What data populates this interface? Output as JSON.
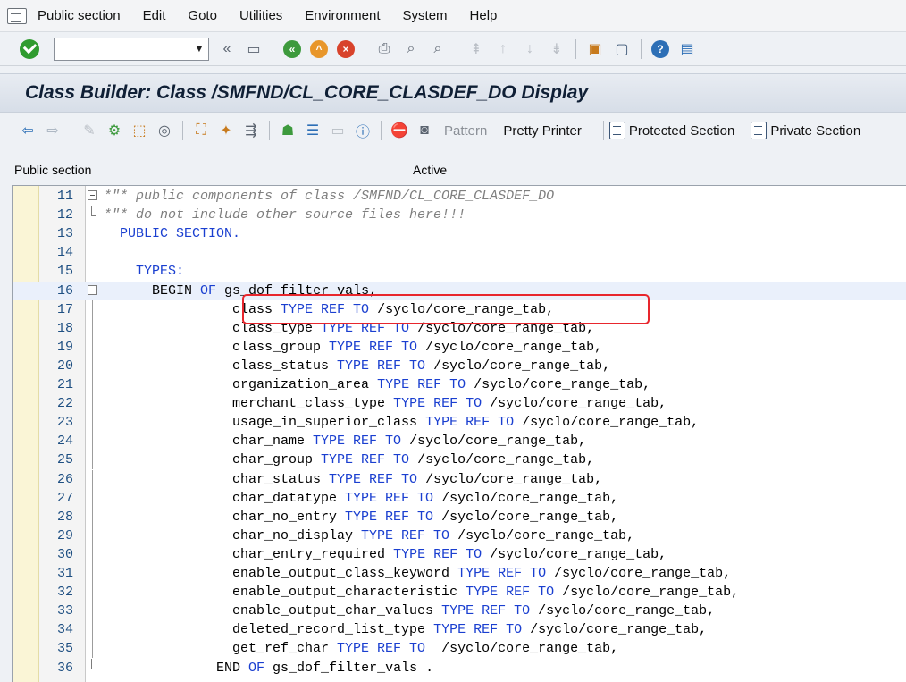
{
  "menu": [
    "Public section",
    "Edit",
    "Goto",
    "Utilities",
    "Environment",
    "System",
    "Help"
  ],
  "title": "Class Builder: Class /SMFND/CL_CORE_CLASDEF_DO Display",
  "app_toolbar": {
    "pattern_label": "Pattern",
    "pretty_printer_label": "Pretty Printer",
    "protected_section_label": "Protected Section",
    "private_section_label": "Private Section"
  },
  "status": {
    "section": "Public section",
    "state": "Active"
  },
  "command_field": {
    "value": ""
  },
  "code_lines": [
    {
      "n": "11",
      "fold": "open",
      "parts": [
        [
          "cmt",
          "*\"* public components of class /SMFND/CL_CORE_CLASDEF_DO"
        ]
      ]
    },
    {
      "n": "12",
      "fold": "end",
      "parts": [
        [
          "cmt",
          "*\"* do not include other source files here!!!"
        ]
      ]
    },
    {
      "n": "13",
      "fold": "",
      "parts": [
        [
          "id",
          "  "
        ],
        [
          "kw",
          "PUBLIC SECTION."
        ]
      ]
    },
    {
      "n": "14",
      "fold": "",
      "parts": []
    },
    {
      "n": "15",
      "fold": "",
      "parts": [
        [
          "id",
          "    "
        ],
        [
          "kw",
          "TYPES:"
        ]
      ]
    },
    {
      "n": "16",
      "fold": "open",
      "parts": [
        [
          "id",
          "      BEGIN "
        ],
        [
          "kw",
          "OF"
        ],
        [
          "id",
          " gs_dof_filter_vals,"
        ]
      ]
    },
    {
      "n": "17",
      "fold": "line",
      "parts": [
        [
          "id",
          "                class "
        ],
        [
          "kw",
          "TYPE REF TO"
        ],
        [
          "id",
          " /syclo/core_range_tab,"
        ]
      ]
    },
    {
      "n": "18",
      "fold": "line",
      "parts": [
        [
          "id",
          "                class_type "
        ],
        [
          "kw",
          "TYPE REF TO"
        ],
        [
          "id",
          " /syclo/core_range_tab,"
        ]
      ]
    },
    {
      "n": "19",
      "fold": "line",
      "parts": [
        [
          "id",
          "                class_group "
        ],
        [
          "kw",
          "TYPE REF TO"
        ],
        [
          "id",
          " /syclo/core_range_tab,"
        ]
      ]
    },
    {
      "n": "20",
      "fold": "line",
      "parts": [
        [
          "id",
          "                class_status "
        ],
        [
          "kw",
          "TYPE REF TO"
        ],
        [
          "id",
          " /syclo/core_range_tab,"
        ]
      ]
    },
    {
      "n": "21",
      "fold": "line",
      "parts": [
        [
          "id",
          "                organization_area "
        ],
        [
          "kw",
          "TYPE REF TO"
        ],
        [
          "id",
          " /syclo/core_range_tab,"
        ]
      ]
    },
    {
      "n": "22",
      "fold": "line",
      "parts": [
        [
          "id",
          "                merchant_class_type "
        ],
        [
          "kw",
          "TYPE REF TO"
        ],
        [
          "id",
          " /syclo/core_range_tab,"
        ]
      ]
    },
    {
      "n": "23",
      "fold": "line",
      "parts": [
        [
          "id",
          "                usage_in_superior_class "
        ],
        [
          "kw",
          "TYPE REF TO"
        ],
        [
          "id",
          " /syclo/core_range_tab,"
        ]
      ]
    },
    {
      "n": "24",
      "fold": "line",
      "parts": [
        [
          "id",
          "                char_name "
        ],
        [
          "kw",
          "TYPE REF TO"
        ],
        [
          "id",
          " /syclo/core_range_tab,"
        ]
      ]
    },
    {
      "n": "25",
      "fold": "line",
      "parts": [
        [
          "id",
          "                char_group "
        ],
        [
          "kw",
          "TYPE REF TO"
        ],
        [
          "id",
          " /syclo/core_range_tab,"
        ]
      ]
    },
    {
      "n": "26",
      "fold": "line",
      "parts": [
        [
          "id",
          "                char_status "
        ],
        [
          "kw",
          "TYPE REF TO"
        ],
        [
          "id",
          " /syclo/core_range_tab,"
        ]
      ]
    },
    {
      "n": "27",
      "fold": "line",
      "parts": [
        [
          "id",
          "                char_datatype "
        ],
        [
          "kw",
          "TYPE REF TO"
        ],
        [
          "id",
          " /syclo/core_range_tab,"
        ]
      ]
    },
    {
      "n": "28",
      "fold": "line",
      "parts": [
        [
          "id",
          "                char_no_entry "
        ],
        [
          "kw",
          "TYPE REF TO"
        ],
        [
          "id",
          " /syclo/core_range_tab,"
        ]
      ]
    },
    {
      "n": "29",
      "fold": "line",
      "parts": [
        [
          "id",
          "                char_no_display "
        ],
        [
          "kw",
          "TYPE REF TO"
        ],
        [
          "id",
          " /syclo/core_range_tab,"
        ]
      ]
    },
    {
      "n": "30",
      "fold": "line",
      "parts": [
        [
          "id",
          "                char_entry_required "
        ],
        [
          "kw",
          "TYPE REF TO"
        ],
        [
          "id",
          " /syclo/core_range_tab,"
        ]
      ]
    },
    {
      "n": "31",
      "fold": "line",
      "parts": [
        [
          "id",
          "                enable_output_class_keyword "
        ],
        [
          "kw",
          "TYPE REF TO"
        ],
        [
          "id",
          " /syclo/core_range_tab,"
        ]
      ]
    },
    {
      "n": "32",
      "fold": "line",
      "parts": [
        [
          "id",
          "                enable_output_characteristic "
        ],
        [
          "kw",
          "TYPE REF TO"
        ],
        [
          "id",
          " /syclo/core_range_tab,"
        ]
      ]
    },
    {
      "n": "33",
      "fold": "line",
      "parts": [
        [
          "id",
          "                enable_output_char_values "
        ],
        [
          "kw",
          "TYPE REF TO"
        ],
        [
          "id",
          " /syclo/core_range_tab,"
        ]
      ]
    },
    {
      "n": "34",
      "fold": "line",
      "parts": [
        [
          "id",
          "                deleted_record_list_type "
        ],
        [
          "kw",
          "TYPE REF TO"
        ],
        [
          "id",
          " /syclo/core_range_tab,"
        ]
      ]
    },
    {
      "n": "35",
      "fold": "line",
      "parts": [
        [
          "id",
          "                get_ref_char "
        ],
        [
          "kw",
          "TYPE REF TO"
        ],
        [
          "id",
          "  /syclo/core_range_tab,"
        ]
      ]
    },
    {
      "n": "36",
      "fold": "end",
      "parts": [
        [
          "id",
          "              END "
        ],
        [
          "kw",
          "OF"
        ],
        [
          "id",
          " gs_dof_filter_vals ."
        ]
      ]
    }
  ]
}
